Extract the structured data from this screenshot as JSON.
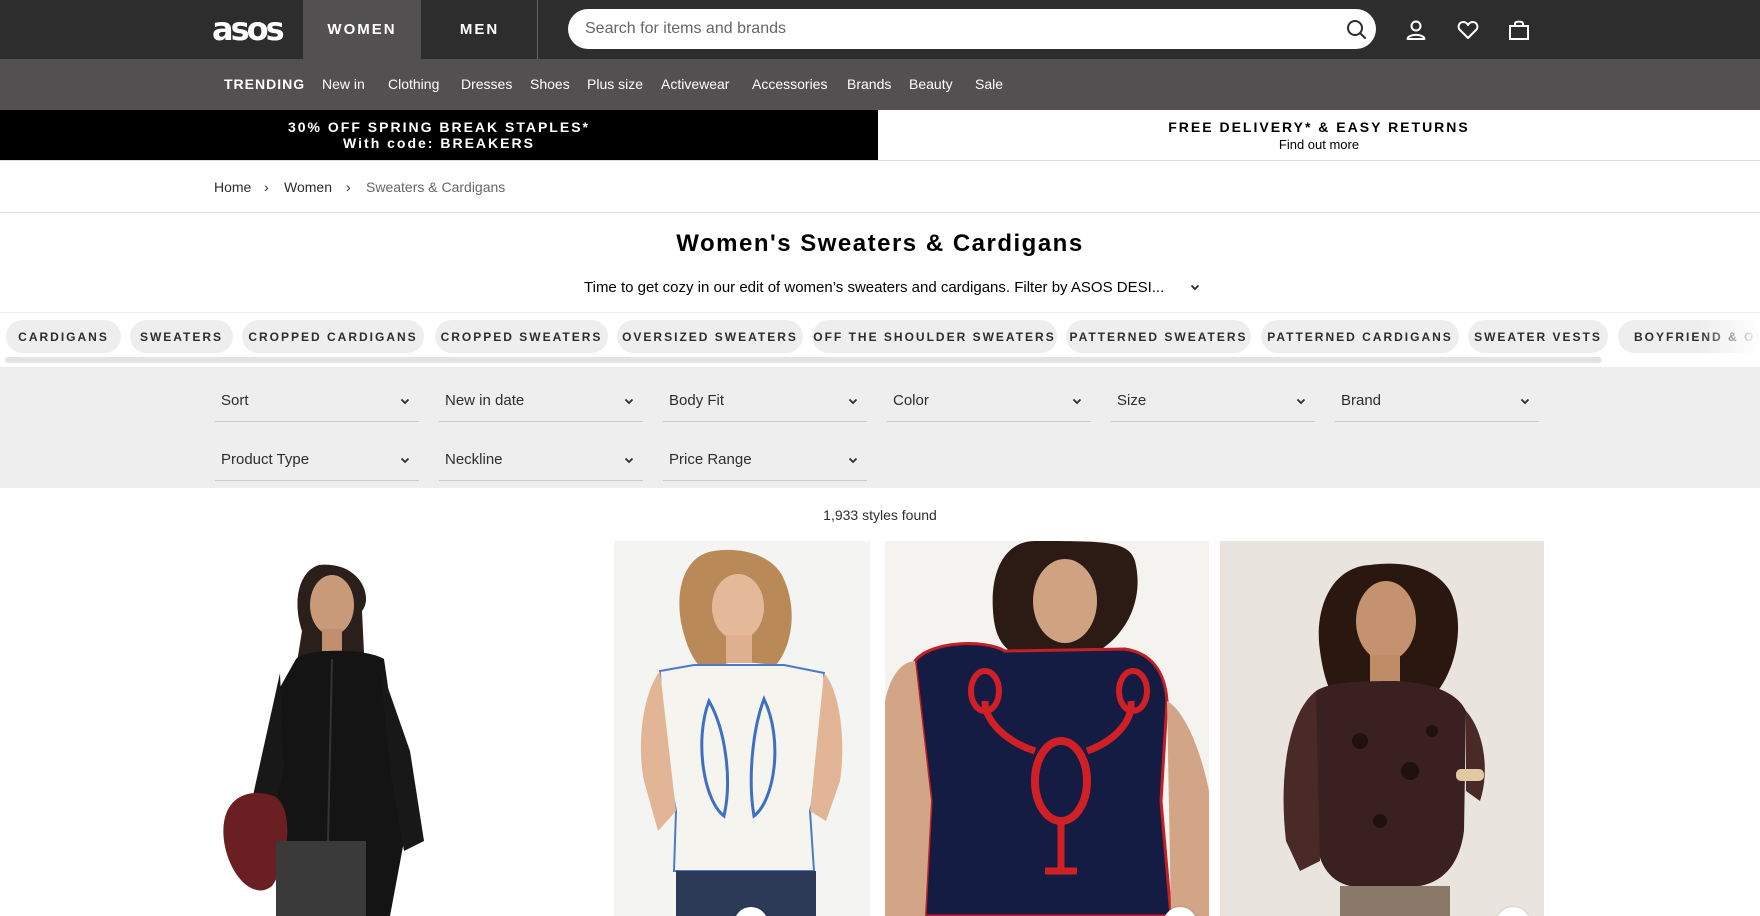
{
  "header": {
    "logo": "asos",
    "gender_tabs": [
      "WOMEN",
      "MEN"
    ],
    "search": {
      "placeholder": "Search for items and brands"
    }
  },
  "nav": {
    "items": [
      "TRENDING",
      "New in",
      "Clothing",
      "Dresses",
      "Shoes",
      "Plus size",
      "Activewear",
      "Accessories",
      "Brands",
      "Beauty",
      "Sale"
    ]
  },
  "promo": {
    "left_line1": "30% OFF SPRING BREAK STAPLES*",
    "left_line2": "With code: BREAKERS",
    "right_line1": "FREE DELIVERY* & EASY RETURNS",
    "right_line2": "Find out more"
  },
  "breadcrumb": {
    "items": [
      "Home",
      "Women",
      "Sweaters & Cardigans"
    ],
    "separator": "›"
  },
  "page": {
    "title": "Women's Sweaters & Cardigans",
    "description": "Time to get cozy in our edit of women’s sweaters and cardigans. Filter by ASOS DESI..."
  },
  "chips": [
    "CARDIGANS",
    "SWEATERS",
    "CROPPED CARDIGANS",
    "CROPPED SWEATERS",
    "OVERSIZED SWEATERS",
    "OFF THE SHOULDER SWEATERS",
    "PATTERNED SWEATERS",
    "PATTERNED CARDIGANS",
    "SWEATER VESTS",
    "BOYFRIEND & OVERSIZED"
  ],
  "filters": [
    "Sort",
    "New in date",
    "Body Fit",
    "Color",
    "Size",
    "Brand",
    "Product Type",
    "Neckline",
    "Price Range"
  ],
  "results": {
    "count_text": "1,933 styles found"
  },
  "colors": {
    "topbar": "#2d2d2d",
    "navbar": "#525050",
    "promo_left": "#000000",
    "filter_bg": "#eeeeee",
    "chip_bg": "#eeeeee"
  }
}
